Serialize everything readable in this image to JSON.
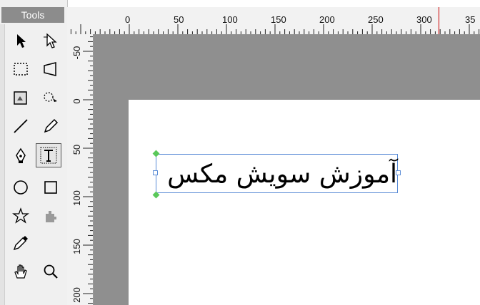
{
  "tools_panel": {
    "title": "Tools",
    "tools": [
      {
        "name": "pointer-tool",
        "icon": "arrow-icon"
      },
      {
        "name": "subselect-tool",
        "icon": "hollow-arrow-icon"
      },
      {
        "name": "marquee-tool",
        "icon": "dotted-rectangle-icon"
      },
      {
        "name": "distort-tool",
        "icon": "distort-icon"
      },
      {
        "name": "crop-tool",
        "icon": "crop-icon"
      },
      {
        "name": "lasso-tool",
        "icon": "lasso-icon"
      },
      {
        "name": "line-tool",
        "icon": "line-icon"
      },
      {
        "name": "pencil-tool",
        "icon": "pencil-icon"
      },
      {
        "name": "pen-tool",
        "icon": "pen-nib-icon"
      },
      {
        "name": "text-tool",
        "icon": "text-t-icon"
      },
      {
        "name": "ellipse-tool",
        "icon": "circle-icon"
      },
      {
        "name": "rectangle-tool",
        "icon": "square-icon"
      },
      {
        "name": "star-tool",
        "icon": "star-icon"
      },
      {
        "name": "puzzle-tool",
        "icon": "puzzle-icon"
      },
      {
        "name": "eyedropper-tool",
        "icon": "eyedropper-icon"
      },
      {
        "name": "hand-tool",
        "icon": "hand-icon"
      },
      {
        "name": "zoom-tool",
        "icon": "magnifier-icon"
      }
    ],
    "active_tool": "text-tool"
  },
  "ruler_top": {
    "labels": [
      "0",
      "50",
      "100",
      "150",
      "200",
      "250",
      "300",
      "35"
    ]
  },
  "ruler_left": {
    "labels": [
      "-50",
      "0",
      "50",
      "100",
      "150",
      "200"
    ]
  },
  "canvas": {
    "text": "آموزش سویش مکس"
  },
  "colors": {
    "workspace": "#8f8f8f",
    "canvas": "#ffffff",
    "selection": "#5a8cd6",
    "cursor_line": "#cc0000"
  }
}
